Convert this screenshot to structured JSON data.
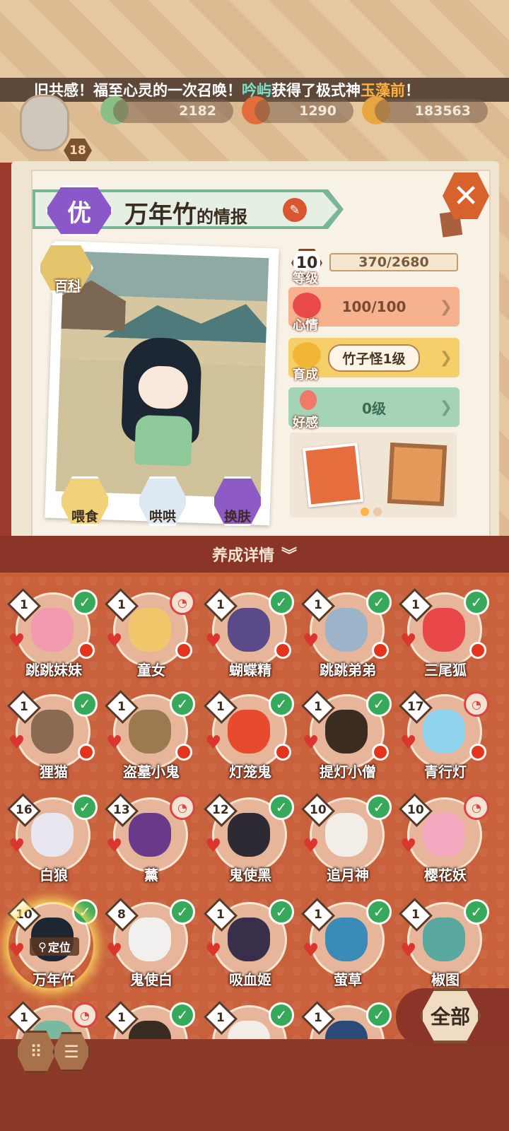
{
  "ticker": {
    "text_a": "旧共感！福至心灵的一次召唤！",
    "player": "吟屿",
    "text_b": "获得了极式神",
    "reward": "玉藻前",
    "text_c": "！"
  },
  "resources": [
    {
      "value": "2182"
    },
    {
      "value": "1290"
    },
    {
      "value": "183563"
    }
  ],
  "player_level": "18",
  "info": {
    "rank": "优",
    "name": "万年竹",
    "name_suffix": "的情报",
    "encyclopedia_label": "百科",
    "level_label": "等级",
    "level": "10",
    "exp": "370/2680",
    "mood_label": "心情",
    "mood": "100/100",
    "raise_label": "育成",
    "raise_value": "竹子怪1级",
    "favor_label": "好感",
    "favor": "0级",
    "actions": [
      {
        "label": "喂食"
      },
      {
        "label": "哄哄"
      },
      {
        "label": "换肤"
      }
    ]
  },
  "detail_title": "养成详情",
  "shikigami": [
    {
      "name": "跳跳妹妹",
      "level": "1",
      "status": "check",
      "color": "#f19ab0"
    },
    {
      "name": "童女",
      "level": "1",
      "status": "lock",
      "color": "#f2c66b"
    },
    {
      "name": "蝴蝶精",
      "level": "1",
      "status": "check",
      "color": "#5a4a8a"
    },
    {
      "name": "跳跳弟弟",
      "level": "1",
      "status": "check",
      "color": "#9cb3c9"
    },
    {
      "name": "三尾狐",
      "level": "1",
      "status": "check",
      "color": "#e8484a"
    },
    {
      "name": "狸猫",
      "level": "1",
      "status": "check",
      "color": "#8a6a52"
    },
    {
      "name": "盗墓小鬼",
      "level": "1",
      "status": "check",
      "color": "#9b7a52"
    },
    {
      "name": "灯笼鬼",
      "level": "1",
      "status": "check",
      "color": "#e84a2e"
    },
    {
      "name": "提灯小僧",
      "level": "1",
      "status": "check",
      "color": "#3b2c22"
    },
    {
      "name": "青行灯",
      "level": "17",
      "status": "lock",
      "color": "#8fd3ec"
    },
    {
      "name": "白狼",
      "level": "16",
      "status": "check",
      "color": "#e9e6f0"
    },
    {
      "name": "薰",
      "level": "13",
      "status": "lock",
      "color": "#6a3a8a"
    },
    {
      "name": "鬼使黑",
      "level": "12",
      "status": "check",
      "color": "#2d2a33"
    },
    {
      "name": "追月神",
      "level": "10",
      "status": "check",
      "color": "#f2ede6"
    },
    {
      "name": "樱花妖",
      "level": "10",
      "status": "lock",
      "color": "#f4a9c0"
    },
    {
      "name": "万年竹",
      "level": "10",
      "status": "check",
      "color": "#1d2633"
    },
    {
      "name": "鬼使白",
      "level": "8",
      "status": "check",
      "color": "#f2f0ee"
    },
    {
      "name": "吸血姬",
      "level": "1",
      "status": "check",
      "color": "#3a2f4a"
    },
    {
      "name": "萤草",
      "level": "1",
      "status": "check",
      "color": "#3b8bb8"
    },
    {
      "name": "椒图",
      "level": "1",
      "status": "check",
      "color": "#58a8a0"
    },
    {
      "name": "",
      "level": "1",
      "status": "lock",
      "color": "#7ab8a0"
    },
    {
      "name": "",
      "level": "1",
      "status": "check",
      "color": "#3b2c22"
    },
    {
      "name": "",
      "level": "1",
      "status": "check",
      "color": "#f2ede6"
    },
    {
      "name": "",
      "level": "1",
      "status": "check",
      "color": "#2a4a7a"
    },
    {
      "name": "",
      "level": "",
      "status": "none",
      "color": "#c9603c"
    }
  ],
  "locate_label": "定位",
  "all_label": "全部"
}
